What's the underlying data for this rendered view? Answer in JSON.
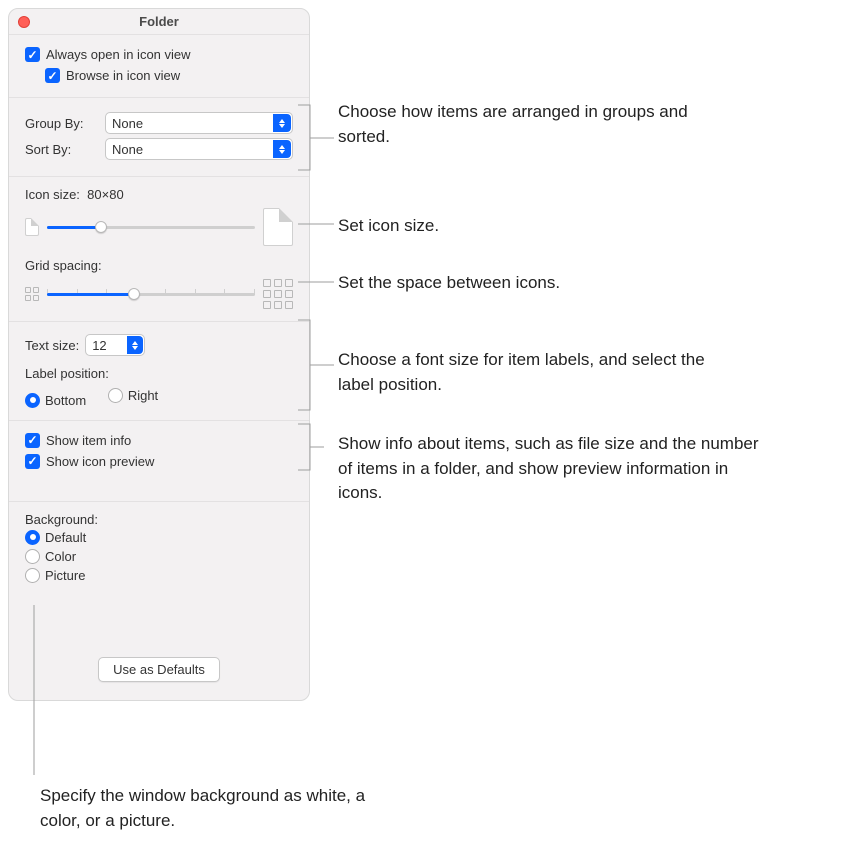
{
  "window": {
    "title": "Folder"
  },
  "viewOptions": {
    "alwaysOpen": "Always open in icon view",
    "browse": "Browse in icon view"
  },
  "grouping": {
    "groupByLabel": "Group By:",
    "groupByValue": "None",
    "sortByLabel": "Sort By:",
    "sortByValue": "None"
  },
  "iconSize": {
    "label": "Icon size:",
    "value": "80×80",
    "sliderPercent": 26
  },
  "gridSpacing": {
    "label": "Grid spacing:",
    "sliderPercent": 42
  },
  "text": {
    "sizeLabel": "Text size:",
    "sizeValue": "12",
    "positionLabel": "Label position:",
    "bottom": "Bottom",
    "right": "Right"
  },
  "show": {
    "itemInfo": "Show item info",
    "iconPreview": "Show icon preview"
  },
  "background": {
    "label": "Background:",
    "default": "Default",
    "color": "Color",
    "picture": "Picture"
  },
  "defaultsButton": "Use as Defaults",
  "callouts": {
    "grouping": "Choose how items are arranged in groups and sorted.",
    "iconSize": "Set icon size.",
    "gridSpacing": "Set the space between icons.",
    "text": "Choose a font size for item labels, and select the label position.",
    "show": "Show info about items, such as file size and the number of items in a folder, and show preview information in icons.",
    "background": "Specify the window background as white, a color, or a picture."
  }
}
